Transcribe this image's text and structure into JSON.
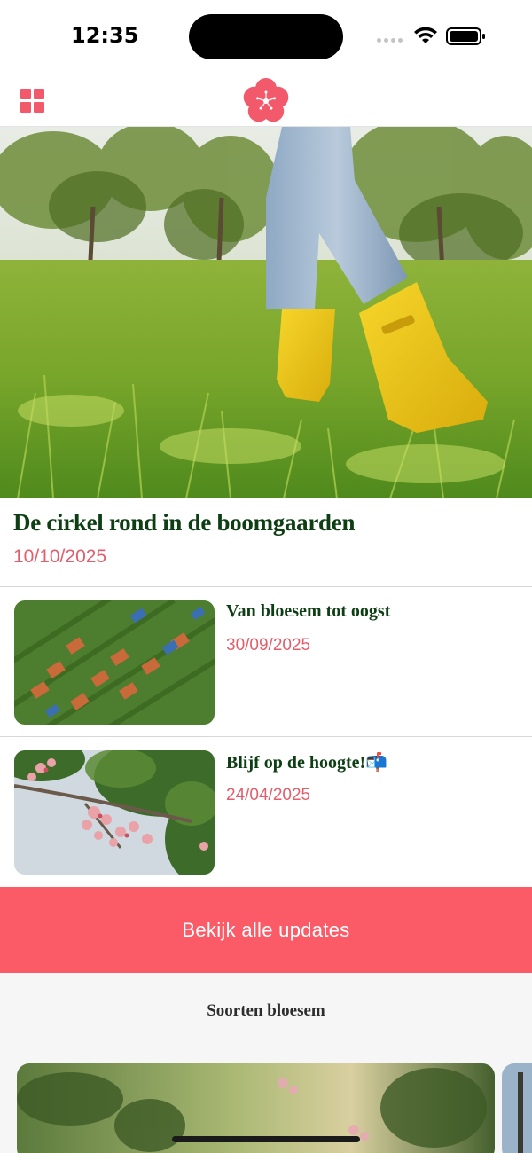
{
  "status_bar": {
    "time": "12:35"
  },
  "nav": {
    "menu_icon": "grid-icon",
    "logo_icon": "blossom-flower-icon",
    "accent_color": "#f25a6b"
  },
  "hero": {
    "title": "De cirkel rond in de boomgaarden",
    "date": "10/10/2025",
    "image_description_icon": "photo-yellow-boots-grass"
  },
  "updates": [
    {
      "title": "Van bloesem tot oogst",
      "date": "30/09/2025"
    },
    {
      "title": "Blijf op de hoogte!📬",
      "date": "24/04/2025"
    }
  ],
  "cta": {
    "label": "Bekijk alle updates",
    "color": "#fb5b66"
  },
  "section": {
    "title": "Soorten bloesem"
  }
}
